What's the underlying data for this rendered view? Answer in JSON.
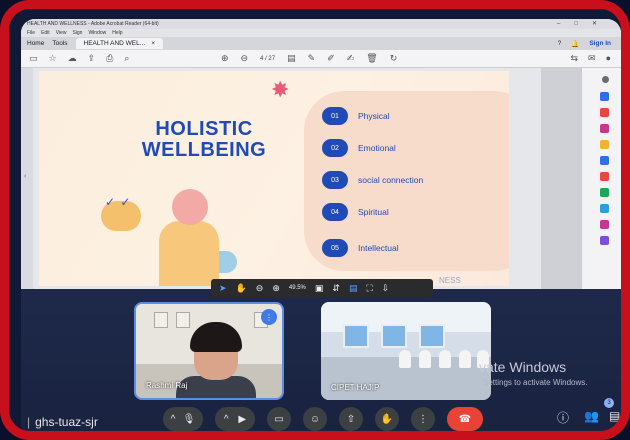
{
  "acrobat": {
    "window_title": "HEALTH AND WELLNESS - Adobe Acrobat Reader (64-bit)",
    "menu": [
      "File",
      "Edit",
      "View",
      "Sign",
      "Window",
      "Help"
    ],
    "tabs": {
      "home": "Home",
      "tools": "Tools",
      "doc": "HEALTH AND WEL...",
      "close": "×"
    },
    "sign_in": "Sign In",
    "page_indicator": "4 / 27",
    "zoom": "49.5%"
  },
  "slide": {
    "headline_line1": "HOLISTIC",
    "headline_line2": "WELLBEING",
    "items": [
      {
        "num": "01",
        "label": "Physical"
      },
      {
        "num": "02",
        "label": "Emotional"
      },
      {
        "num": "03",
        "label": "social connection"
      },
      {
        "num": "04",
        "label": "Spiritual"
      },
      {
        "num": "05",
        "label": "Intellectual"
      }
    ],
    "faded_text": "NESS"
  },
  "meet": {
    "tile1_name": "Rashmi Raj",
    "tile2_name": "CIPET HAJIP",
    "meeting_code": "ghs-tuaz-sjr",
    "participants_badge": "3",
    "watermark_title": "vate Windows",
    "watermark_sub": "Settings to activate Windows."
  },
  "colors": {
    "frame": "#c8101c",
    "slide_blue": "#1f4ab8",
    "end_call": "#ea4335"
  }
}
